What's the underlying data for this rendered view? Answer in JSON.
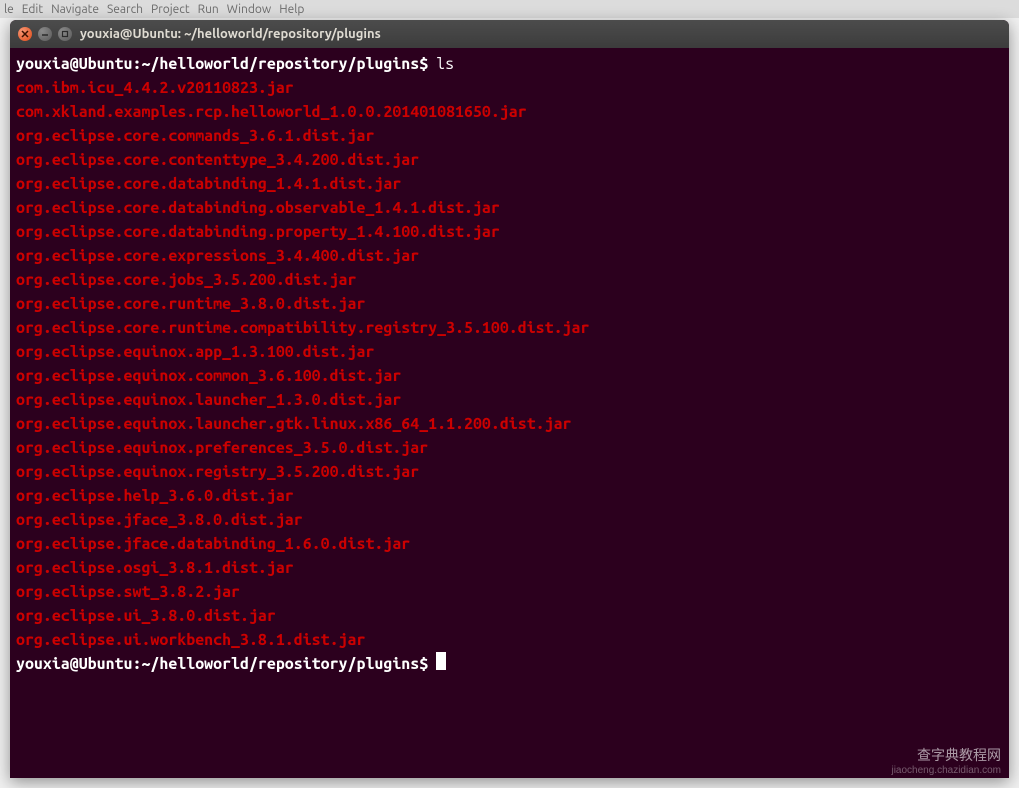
{
  "menubar": {
    "items": [
      "le",
      "Edit",
      "Navigate",
      "Search",
      "Project",
      "Run",
      "Window",
      "Help"
    ]
  },
  "window": {
    "title": "youxia@Ubuntu: ~/helloworld/repository/plugins"
  },
  "terminal": {
    "prompt": "youxia@Ubuntu:~/helloworld/repository/plugins$",
    "command": "ls",
    "files": [
      "com.ibm.icu_4.4.2.v20110823.jar",
      "com.xkland.examples.rcp.helloworld_1.0.0.201401081650.jar",
      "org.eclipse.core.commands_3.6.1.dist.jar",
      "org.eclipse.core.contenttype_3.4.200.dist.jar",
      "org.eclipse.core.databinding_1.4.1.dist.jar",
      "org.eclipse.core.databinding.observable_1.4.1.dist.jar",
      "org.eclipse.core.databinding.property_1.4.100.dist.jar",
      "org.eclipse.core.expressions_3.4.400.dist.jar",
      "org.eclipse.core.jobs_3.5.200.dist.jar",
      "org.eclipse.core.runtime_3.8.0.dist.jar",
      "org.eclipse.core.runtime.compatibility.registry_3.5.100.dist.jar",
      "org.eclipse.equinox.app_1.3.100.dist.jar",
      "org.eclipse.equinox.common_3.6.100.dist.jar",
      "org.eclipse.equinox.launcher_1.3.0.dist.jar",
      "org.eclipse.equinox.launcher.gtk.linux.x86_64_1.1.200.dist.jar",
      "org.eclipse.equinox.preferences_3.5.0.dist.jar",
      "org.eclipse.equinox.registry_3.5.200.dist.jar",
      "org.eclipse.help_3.6.0.dist.jar",
      "org.eclipse.jface_3.8.0.dist.jar",
      "org.eclipse.jface.databinding_1.6.0.dist.jar",
      "org.eclipse.osgi_3.8.1.dist.jar",
      "org.eclipse.swt_3.8.2.jar",
      "org.eclipse.ui_3.8.0.dist.jar",
      "org.eclipse.ui.workbench_3.8.1.dist.jar"
    ]
  },
  "watermark": {
    "main": "查字典教程网",
    "sub": "jiaocheng.chazidian.com"
  }
}
